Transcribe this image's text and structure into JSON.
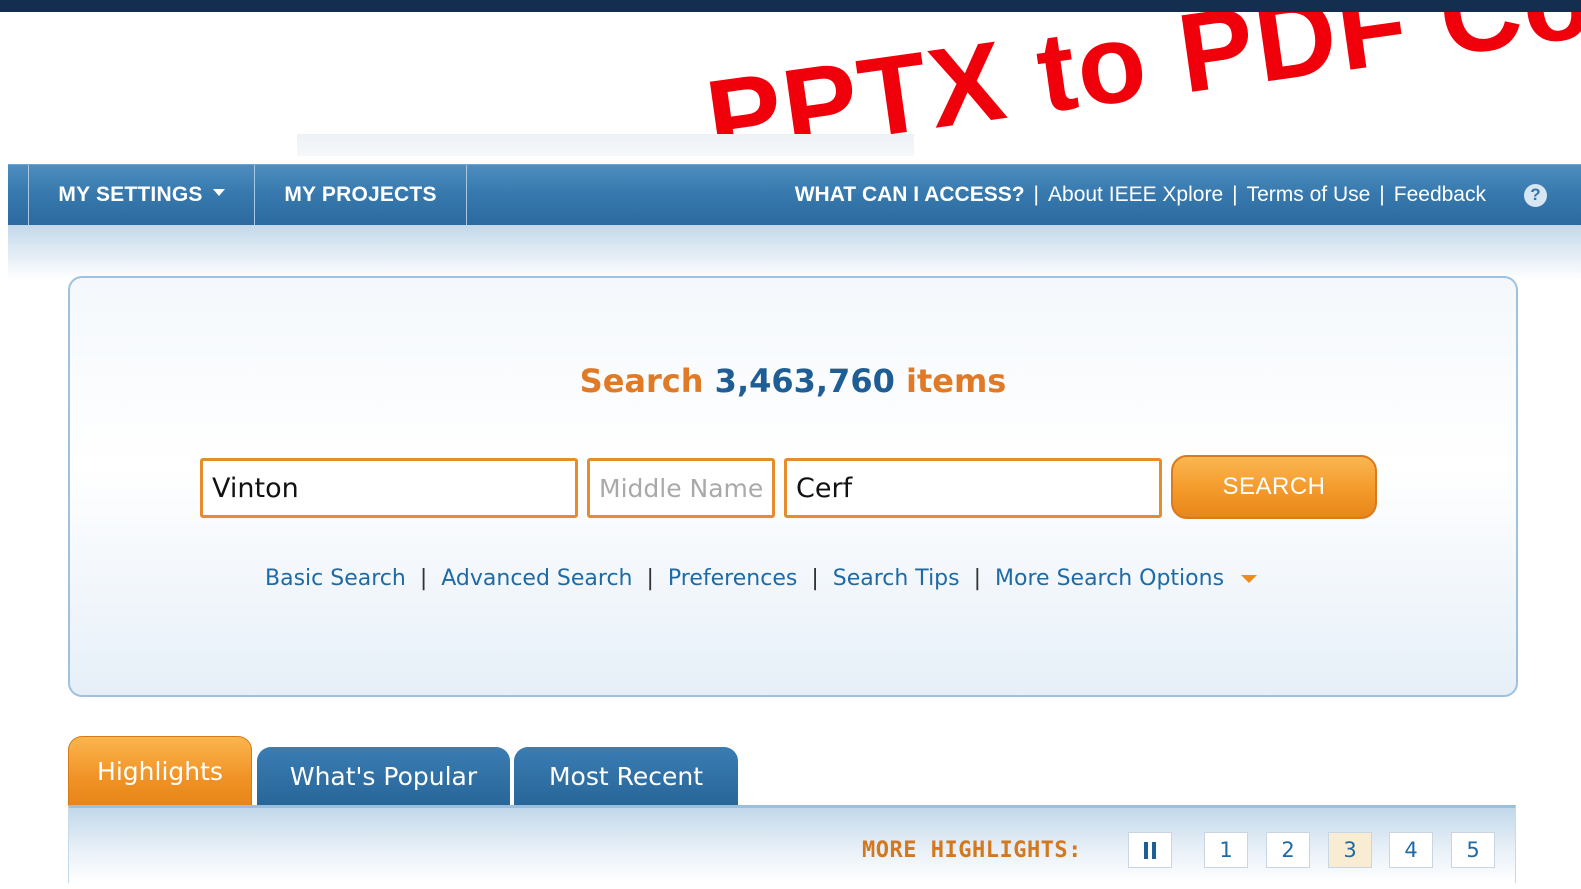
{
  "watermark": {
    "text": "PPTX to PDF Converter"
  },
  "nav": {
    "my_settings": "MY SETTINGS",
    "my_projects": "MY PROJECTS",
    "what_can_i_access": "WHAT CAN I ACCESS?",
    "about": "About IEEE Xplore",
    "terms": "Terms of Use",
    "feedback": "Feedback",
    "separator": "|",
    "help_icon": "help-icon",
    "help_glyph": "?"
  },
  "search": {
    "headline_prefix": "Search",
    "headline_count": "3,463,760",
    "headline_suffix": "items",
    "first_name_value": "Vinton",
    "middle_name_placeholder": "Middle Name",
    "last_name_value": "Cerf",
    "button_label": "SEARCH",
    "links": {
      "basic": "Basic Search",
      "advanced": "Advanced Search",
      "preferences": "Preferences",
      "tips": "Search Tips",
      "more_options": "More Search Options",
      "separator": "|"
    }
  },
  "tabs": [
    {
      "label": "Highlights",
      "active": true
    },
    {
      "label": "What's Popular",
      "active": false
    },
    {
      "label": "Most Recent",
      "active": false
    }
  ],
  "highlights": {
    "label": "MORE HIGHLIGHTS:",
    "pause_icon": "pause-icon",
    "pages": [
      "1",
      "2",
      "3",
      "4",
      "5"
    ],
    "active_page": "3"
  },
  "colors": {
    "nav_blue": "#3678ad",
    "accent_orange": "#f39a2a",
    "link_blue": "#1f6aa5",
    "headline_orange": "#e07a26",
    "watermark_red": "#f0000a"
  }
}
